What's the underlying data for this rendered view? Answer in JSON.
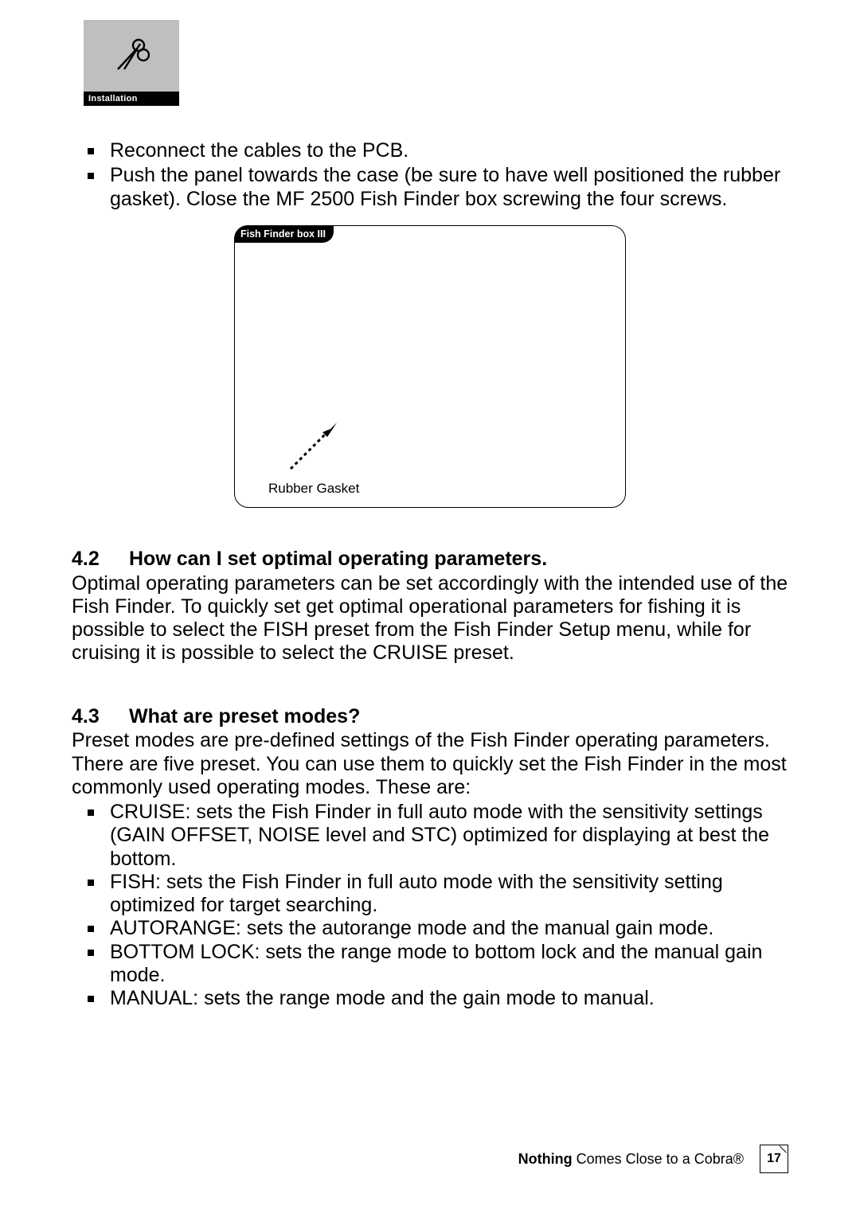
{
  "topbox": {
    "label": "Installation"
  },
  "steps": [
    "Reconnect the cables to the PCB.",
    "Push the panel towards the case (be sure to have well positioned the rubber gasket). Close the MF 2500 Fish Finder box screwing the four screws."
  ],
  "figure": {
    "tab": "Fish Finder box III",
    "annotation": "Rubber Gasket"
  },
  "sections": [
    {
      "num": "4.2",
      "title": "How can I set optimal operating parameters.",
      "body": "Optimal operating parameters can be set accordingly with the intended use of the Fish Finder. To quickly set get optimal operational parameters for fishing it is possible to select the FISH preset from the Fish Finder Setup menu, while for cruising it is possible to select the CRUISE preset."
    },
    {
      "num": "4.3",
      "title": "What are preset modes?",
      "body": "Preset modes are pre-defined settings of the Fish Finder operating parameters. There are five preset. You can use them to quickly set the Fish Finder in the most commonly used operating modes. These are:",
      "items": [
        "CRUISE: sets the Fish Finder in full auto mode with the sensitivity settings (GAIN OFFSET, NOISE level and STC) optimized for displaying at best the bottom.",
        "FISH: sets the Fish Finder in full auto mode with the sensitivity setting optimized for target searching.",
        "AUTORANGE: sets the autorange mode and the manual gain mode.",
        "BOTTOM LOCK: sets the range mode to bottom lock and the manual gain mode.",
        "MANUAL: sets the range mode and the gain mode to manual."
      ]
    }
  ],
  "footer": {
    "bold": "Nothing",
    "rest": " Comes Close to a Cobra",
    "reg": "®",
    "page": "17"
  }
}
